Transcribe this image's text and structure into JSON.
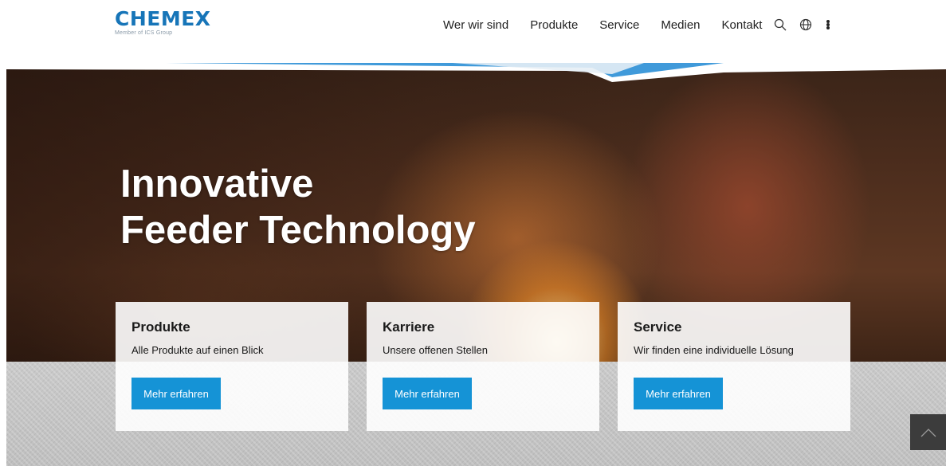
{
  "brand": {
    "name": "CHEMEX",
    "tagline": "Member of ICS Group"
  },
  "nav": {
    "items": [
      "Wer wir sind",
      "Produkte",
      "Service",
      "Medien",
      "Kontakt"
    ],
    "icons": [
      "search-icon",
      "globe-icon",
      "more-vertical-icon"
    ]
  },
  "hero": {
    "title_line1": "Innovative",
    "title_line2": "Feeder Technology"
  },
  "cards": [
    {
      "title": "Produkte",
      "text": "Alle Produkte auf einen Blick",
      "button": "Mehr erfahren"
    },
    {
      "title": "Karriere",
      "text": "Unsere offenen Stellen",
      "button": "Mehr erfahren"
    },
    {
      "title": "Service",
      "text": "Wir finden eine individuelle Lösung",
      "button": "Mehr erfahren"
    }
  ],
  "colors": {
    "brand_blue": "#1775b8",
    "button_blue": "#1593d6",
    "scroll_top_bg": "#3c3c3c"
  },
  "scroll_top": {
    "icon": "chevron-up-icon"
  }
}
